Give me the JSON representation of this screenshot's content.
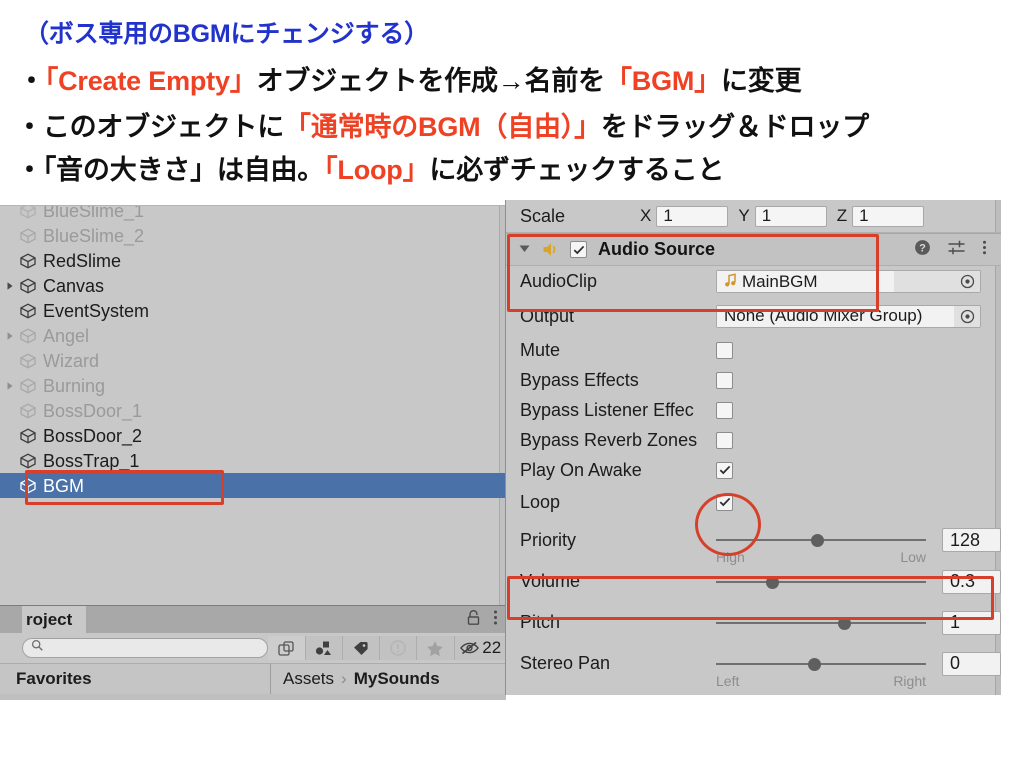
{
  "slide": {
    "title": "（ボス専用のBGMにチェンジする）",
    "bullets": [
      {
        "marker": "・",
        "parts": [
          {
            "text": "「Create Empty」",
            "accent": true
          },
          {
            "text": "オブジェクトを作成→名前を",
            "accent": false
          },
          {
            "text": "「BGM」",
            "accent": true
          },
          {
            "text": "に変更",
            "accent": false
          }
        ]
      },
      {
        "marker": "・",
        "parts": [
          {
            "text": "このオブジェクトに",
            "accent": false
          },
          {
            "text": "「通常時のBGM（自由）」",
            "accent": true
          },
          {
            "text": "をドラッグ＆ドロップ",
            "accent": false
          }
        ]
      },
      {
        "marker": "・",
        "parts": [
          {
            "text": "「音の大きさ」は自由。",
            "accent": false
          },
          {
            "text": "「Loop」",
            "accent": true
          },
          {
            "text": "に必ずチェックすること",
            "accent": false
          }
        ]
      }
    ],
    "title_color": "#2233cc",
    "accent_color": "#ef4123",
    "body_color": "#111111"
  },
  "hierarchy": {
    "items": [
      {
        "label": "BlueSlime_1",
        "dim": true,
        "expandable": false,
        "selected": false
      },
      {
        "label": "BlueSlime_2",
        "dim": true,
        "expandable": false,
        "selected": false
      },
      {
        "label": "RedSlime",
        "dim": false,
        "expandable": false,
        "selected": false
      },
      {
        "label": "Canvas",
        "dim": false,
        "expandable": true,
        "selected": false
      },
      {
        "label": "EventSystem",
        "dim": false,
        "expandable": false,
        "selected": false
      },
      {
        "label": "Angel",
        "dim": true,
        "expandable": true,
        "selected": false
      },
      {
        "label": "Wizard",
        "dim": true,
        "expandable": false,
        "selected": false
      },
      {
        "label": "Burning",
        "dim": true,
        "expandable": true,
        "selected": false
      },
      {
        "label": "BossDoor_1",
        "dim": true,
        "expandable": false,
        "selected": false
      },
      {
        "label": "BossDoor_2",
        "dim": false,
        "expandable": false,
        "selected": false
      },
      {
        "label": "BossTrap_1",
        "dim": false,
        "expandable": false,
        "selected": false
      },
      {
        "label": "BGM",
        "dim": false,
        "expandable": false,
        "selected": true
      }
    ],
    "selection_color": "#4a71a8"
  },
  "project": {
    "tab_label": "roject",
    "lock_icon": "lock-icon",
    "menu_icon": "kebab-menu-icon",
    "search_placeholder": "",
    "search_value": "",
    "toolbar_icons": [
      "type-filter-icon",
      "label-filter-icon",
      "warning-filter-icon",
      "favorite-star-icon",
      "hidden-items-icon"
    ],
    "hidden_count": "22",
    "favorites_label": "Favorites",
    "breadcrumbs": [
      "Assets",
      "MySounds"
    ],
    "breadcrumb_separator": "›"
  },
  "inspector": {
    "scale_row": {
      "label": "Scale",
      "axes": [
        {
          "name": "X",
          "value": "1"
        },
        {
          "name": "Y",
          "value": "1"
        },
        {
          "name": "Z",
          "value": "1"
        }
      ]
    },
    "component": {
      "foldout_icon": "foldout-triangle-down-icon",
      "component_icon": "audio-speaker-icon",
      "enabled": true,
      "title": "Audio Source",
      "help_icon": "help-icon",
      "preset_icon": "preset-sliders-icon",
      "menu_icon": "kebab-menu-icon"
    },
    "object_fields": [
      {
        "label": "AudioClip",
        "value": "MainBGM",
        "icon": "music-note-icon",
        "picker": "object-picker-icon"
      },
      {
        "label": "Output",
        "value": "None (Audio Mixer Group)",
        "icon": null,
        "picker": "object-picker-icon"
      }
    ],
    "checkbox_fields": [
      {
        "label": "Mute",
        "checked": false
      },
      {
        "label": "Bypass Effects",
        "checked": false
      },
      {
        "label": "Bypass Listener Effec",
        "checked": false
      },
      {
        "label": "Bypass Reverb Zones",
        "checked": false
      },
      {
        "label": "Play On Awake",
        "checked": true
      },
      {
        "label": "Loop",
        "checked": true
      }
    ],
    "slider_fields": [
      {
        "label": "Priority",
        "value": "128",
        "fill": 0.52,
        "left_label": "High",
        "right_label": "Low"
      },
      {
        "label": "Volume",
        "value": "0.3",
        "fill": 0.3,
        "left_label": "",
        "right_label": ""
      },
      {
        "label": "Pitch",
        "value": "1",
        "fill": 0.64,
        "left_label": "",
        "right_label": ""
      },
      {
        "label": "Stereo Pan",
        "value": "0",
        "fill": 0.5,
        "left_label": "Left",
        "right_label": "Right"
      }
    ]
  },
  "annotations": {
    "color": "#d6402a",
    "shapes": [
      {
        "name": "bgm-hierarchy-highlight",
        "type": "box"
      },
      {
        "name": "audio-source-header-highlight",
        "type": "box"
      },
      {
        "name": "loop-checkbox-highlight",
        "type": "circle"
      },
      {
        "name": "volume-row-highlight",
        "type": "box"
      }
    ]
  }
}
